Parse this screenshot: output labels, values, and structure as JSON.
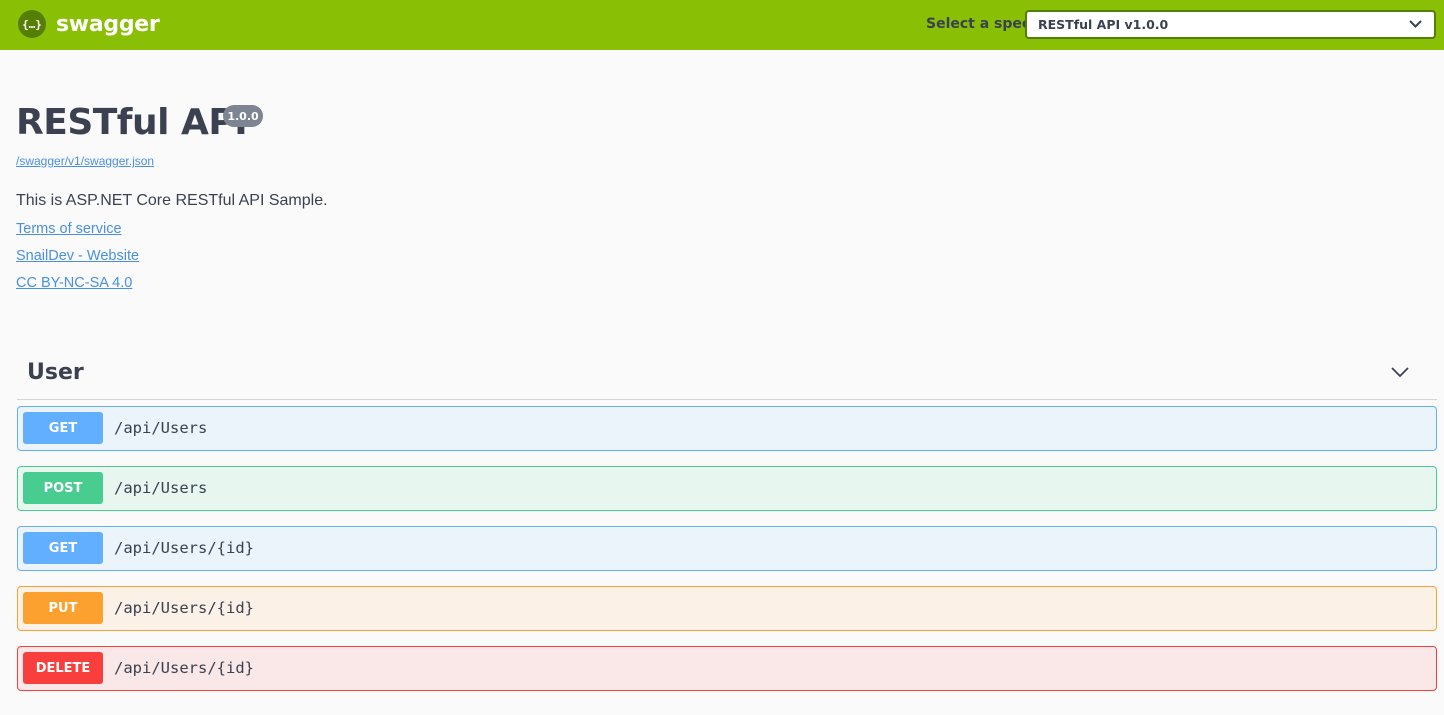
{
  "topbar": {
    "logo_icon_text": "{…}",
    "logo_text": "swagger",
    "select_label": "Select a spec",
    "selected_spec": "RESTful API v1.0.0",
    "color": "#89bf04"
  },
  "info": {
    "title": "RESTful API",
    "version": "1.0.0",
    "spec_url": "/swagger/v1/swagger.json",
    "description": "This is ASP.NET Core RESTful API Sample.",
    "links": {
      "terms": "Terms of service",
      "website": "SnailDev - Website",
      "license": "CC BY-NC-SA 4.0"
    }
  },
  "tag": {
    "name": "User",
    "chevron_icon": "chevron-down-icon"
  },
  "operations": [
    {
      "method": "GET",
      "path": "/api/Users",
      "color": "#61affe"
    },
    {
      "method": "POST",
      "path": "/api/Users",
      "color": "#49cc90"
    },
    {
      "method": "GET",
      "path": "/api/Users/{id}",
      "color": "#61affe"
    },
    {
      "method": "PUT",
      "path": "/api/Users/{id}",
      "color": "#fca130"
    },
    {
      "method": "DELETE",
      "path": "/api/Users/{id}",
      "color": "#f93e3e"
    }
  ]
}
